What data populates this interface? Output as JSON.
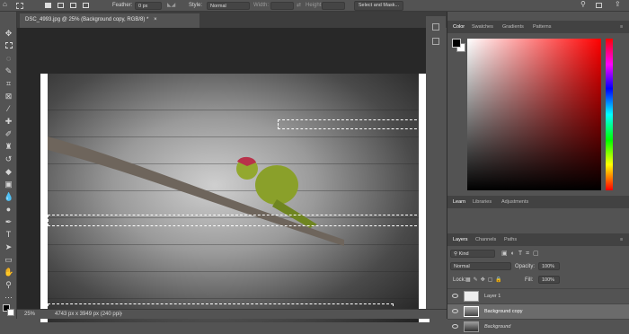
{
  "options_bar": {
    "feather_label": "Feather:",
    "feather_value": "0 px",
    "style_label": "Style:",
    "style_value": "Normal",
    "width_label": "Width:",
    "height_label": "Height:",
    "select_mask_label": "Select and Mask..."
  },
  "document": {
    "tab_title": "DSC_4993.jpg @ 25% (Background copy, RGB/8) *",
    "zoom": "25%",
    "dimensions": "4743 px x 3949 px (240 ppi)"
  },
  "color_panel": {
    "tabs": [
      "Color",
      "Swatches",
      "Gradients",
      "Patterns"
    ],
    "foreground": "#000000",
    "background": "#ffffff"
  },
  "learn_panel": {
    "tabs": [
      "Learn",
      "Libraries",
      "Adjustments"
    ]
  },
  "layers_panel": {
    "tabs": [
      "Layers",
      "Channels",
      "Paths"
    ],
    "kind_label": "Kind",
    "blend_mode": "Normal",
    "opacity_label": "Opacity:",
    "opacity_value": "100%",
    "lock_label": "Lock:",
    "fill_label": "Fill:",
    "fill_value": "100%",
    "layers": [
      {
        "name": "Layer 1"
      },
      {
        "name": "Background copy"
      },
      {
        "name": "Background"
      }
    ]
  }
}
